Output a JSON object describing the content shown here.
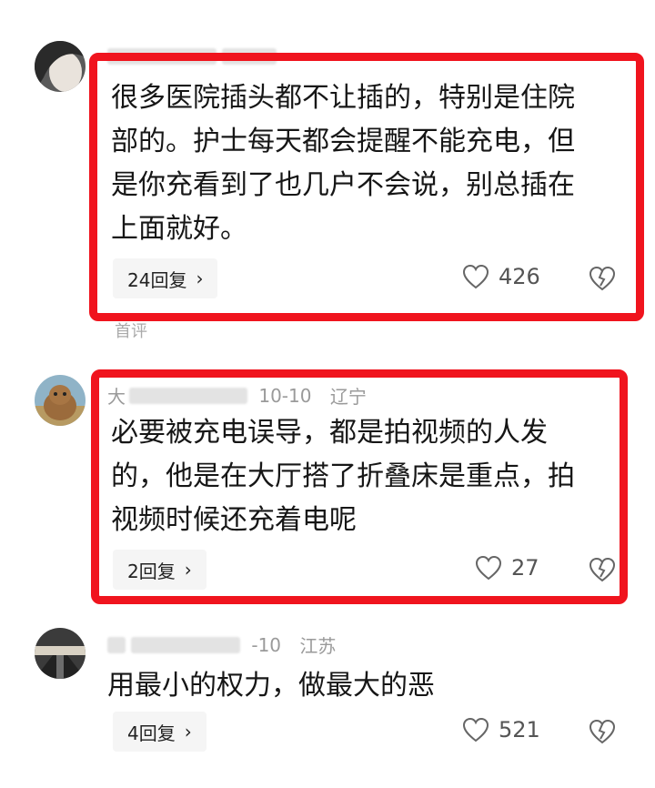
{
  "comments": [
    {
      "text_lines": [
        "很多医院插头都不让插的，特别是住院",
        "部的。护士每天都会提醒不能充电，但",
        "是你充看到了也几户不会说，别总插在",
        "上面就好。"
      ],
      "replies": "24回复",
      "likes": "426"
    },
    {
      "author": "大",
      "date": "10-10",
      "location": "辽宁",
      "text_lines": [
        "必要被充电误导，都是拍视频的人发",
        "的，他是在大厅搭了折叠床是重点，拍",
        "视频时候还充着电呢"
      ],
      "replies": "2回复",
      "likes": "27"
    },
    {
      "date": "-10",
      "location": "江苏",
      "text_lines": [
        "用最小的权力，做最大的恶"
      ],
      "replies": "4回复",
      "likes": "521"
    }
  ],
  "first_label": "首评",
  "icons": {
    "reply_chevron": "chevron-right-icon",
    "like": "heart-icon",
    "dislike": "broken-heart-icon"
  },
  "colors": {
    "highlight": "#f0141e"
  }
}
